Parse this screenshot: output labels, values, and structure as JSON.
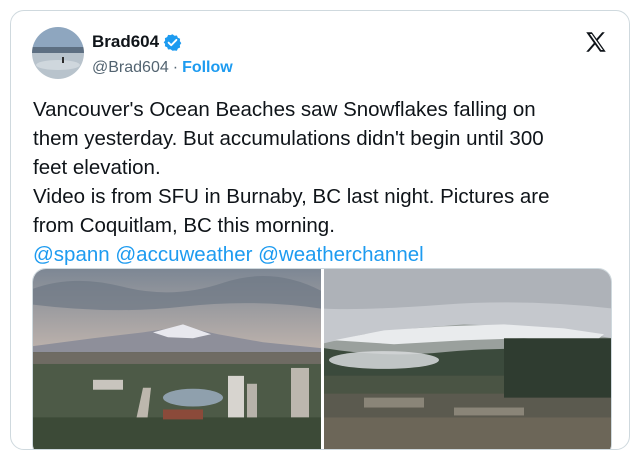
{
  "tweet": {
    "author": {
      "display_name": "Brad604",
      "handle": "@Brad604",
      "separator": "·",
      "follow_label": "Follow",
      "avatar_icon": "beach-avatar",
      "verified_icon": "verified-badge-icon"
    },
    "platform_icon": "x-logo-icon",
    "text_lines": [
      "Vancouver's Ocean Beaches saw Snowflakes falling on",
      "them yesterday. But accumulations didn't begin until 300",
      "feet elevation.",
      "Video is from SFU in Burnaby, BC last night. Pictures are",
      "from Coquitlam, BC this morning."
    ],
    "mentions": [
      "@spann",
      "@accuweather",
      "@weatherchannel"
    ],
    "media": [
      {
        "description_icon": "city-snowy-mountains-photo"
      },
      {
        "description_icon": "snowy-forest-hills-photo"
      }
    ]
  },
  "colors": {
    "accent": "#1d9bf0",
    "text": "#0f1419",
    "secondary_text": "#536471",
    "border": "#cfd9de"
  }
}
